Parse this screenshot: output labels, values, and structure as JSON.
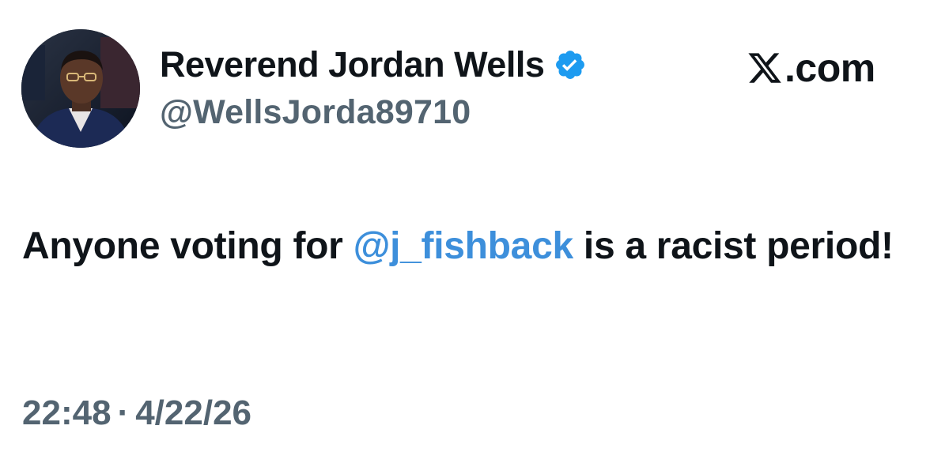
{
  "author": {
    "display_name": "Reverend Jordan Wells",
    "handle": "@WellsJorda89710",
    "verified": true,
    "verified_color": "#1d9bf0"
  },
  "site": {
    "label": ".com",
    "logo_icon": "x-logo-icon"
  },
  "tweet": {
    "text_before": "Anyone voting for ",
    "mention": "@j_fishback",
    "text_after": " is a racist period!",
    "mention_color": "#3d8fdb"
  },
  "meta": {
    "time": "22:48",
    "separator": "·",
    "date": "4/22/26"
  }
}
